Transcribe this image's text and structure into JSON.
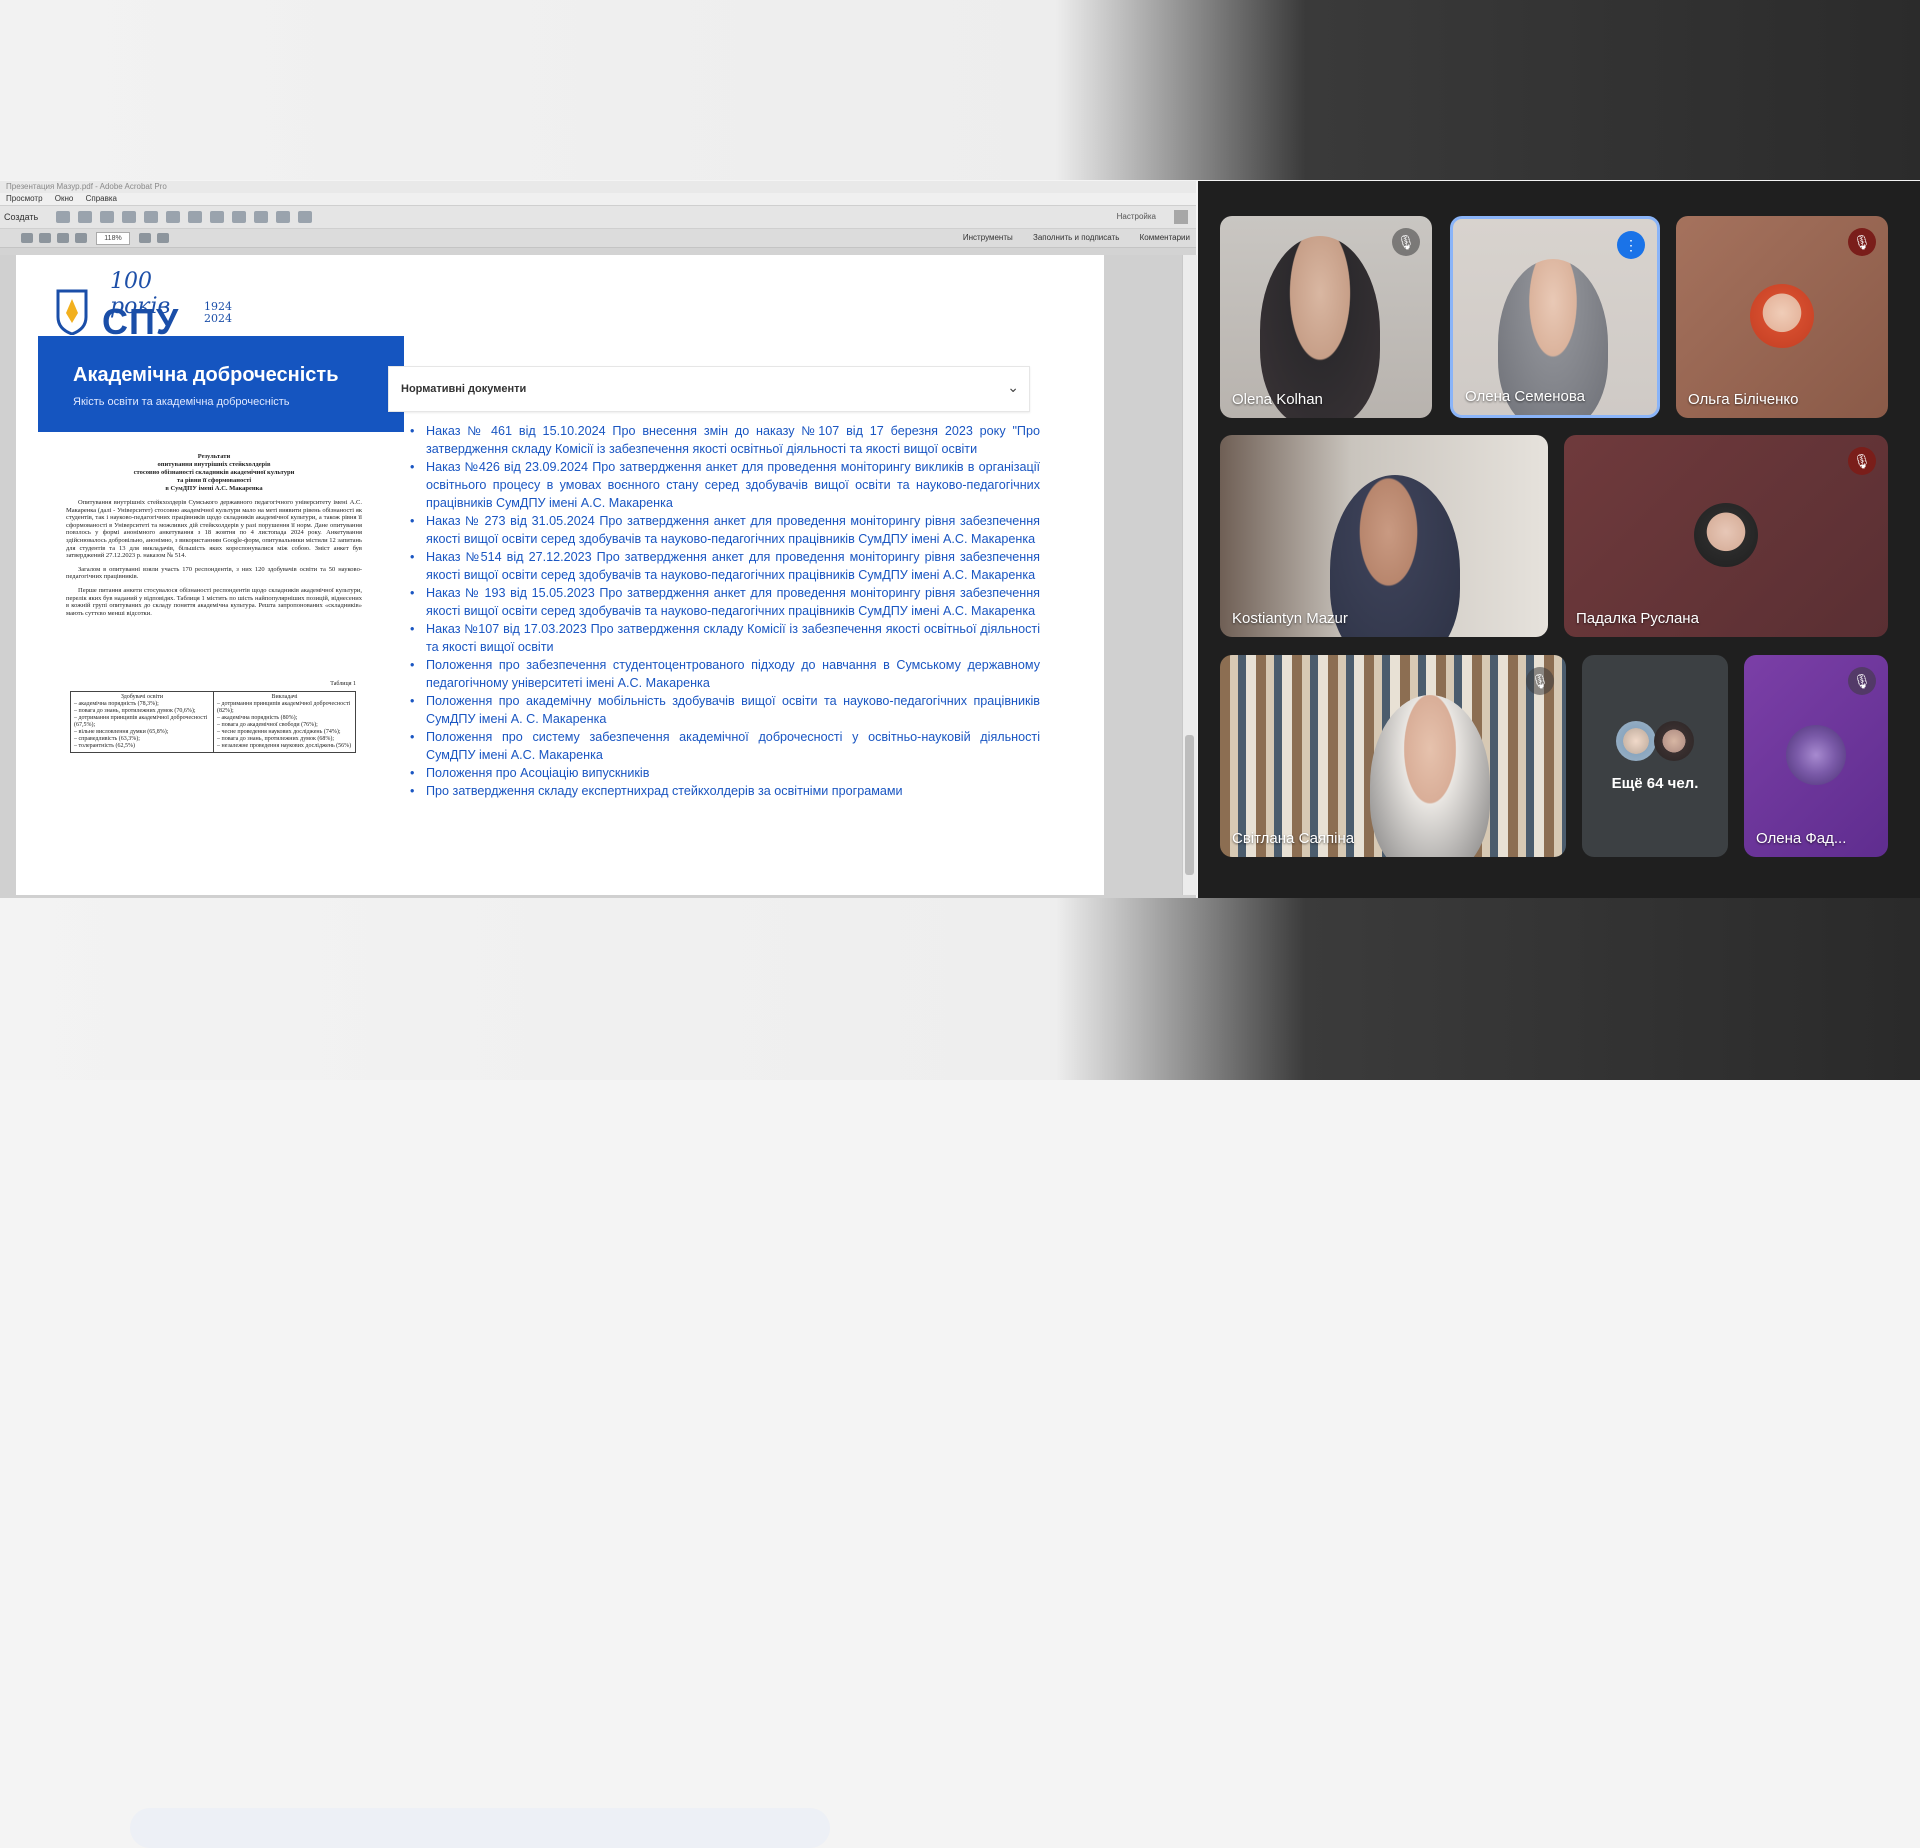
{
  "acrobat": {
    "window_title": "Презентация Мазур.pdf - Adobe Acrobat Pro",
    "menu": [
      "Просмотр",
      "Окно",
      "Справка"
    ],
    "create_label": "Создать",
    "customize_label": "Настройка",
    "zoom": "118%",
    "panels": [
      "Инструменты",
      "Заполнить и подписать",
      "Комментарии"
    ]
  },
  "slide": {
    "logo_text": "СПУ",
    "logo_years": "100 років",
    "logo_range": "1924\n2024",
    "banner_title": "Академічна доброчесність",
    "banner_subtitle": "Якість освіти та академічна доброчесність",
    "scan": {
      "title": "Результати\nопитування внутрішніх стейкхолдерів\nстосовно обізнаності складників академічної культури\nта рівня її сформованості\nв СумДПУ імені А.С. Макаренка",
      "para1": "Опитування внутрішніх стейкхолдерів Сумського державного педагогічного університету імені А.С. Макаренка (далі - Університет) стосовно академічної культури мало на меті виявити рівень обізнаності як студентів, так і науково-педагогічних працівників щодо складників академічної культури, а також рівня її сформованості в Університеті та можливих дій стейкхолдерів у разі порушення її норм. Дане опитування повзлось у формі анонімного анкетування з 18 жовтня по 4 листопада 2024 року. Анкетування здійснювалось добровільно, анонімно, з використанням Google-форм, опитувальники містили 12 запитань для студентів та 13 для викладачів, більшість яких кореспонувалися між собою. Зміст анкет був затверджений 27.12.2023 р. наказом № 514.",
      "para2": "Загалом в опитуванні взяли участь 170 респондентів, з них 120 здобувачів освіти та 50 науково-педагогічних працівників.",
      "para3": "Перше питання анкети стосувалося обізнаності респондентів щодо складників академічної культури, перелік яких був наданий у відповідях. Таблиця 1 містить по шість найпопулярніших позицій, віднесених в кожній групі опитуваних до складу поняття академічна культура. Решта запропонованих «складників» мають суттєво менші відсотки.",
      "table_label": "Таблиця 1",
      "col1_head": "Здобувачі освіти",
      "col1": "– академічна порядність (78,3%);\n– повага до знань, протилежних думок (70,6%);\n– дотримання принципів академічної доброчесності (67,5%);\n– вільне висловлення думки (65,8%);\n– справедливість (63,3%);\n– толерантність (62,5%)",
      "col2_head": "Викладачі",
      "col2": "– дотримання принципів академічної доброчесності (82%);\n– академічна порядність (80%);\n– повага до академічної свободи (76%);\n– чесне проведення наукових досліджень (74%);\n– повага до знань, протилежних думок (68%);\n– незалежне проведення наукових досліджень (56%)"
    },
    "norm_title": "Нормативні документи",
    "documents": [
      "Наказ № 461 від 15.10.2024  Про внесення змін до наказу №107 від 17 березня 2023 року \"Про затвердження складу Комісії із забезпечення якості освітньої діяльності та якості вищої освіти",
      "Наказ №426 від 23.09.2024 Про затвердження анкет для проведення моніторингу викликів в організації освітнього процесу в умовах воєнного стану серед здобувачів вищої освіти та науково-педагогічних працівників СумДПУ імені А.С. Макаренка",
      "Наказ № 273 від 31.05.2024 Про затвердження анкет для проведення моніторингу рівня забезпечення якості вищої освіти серед здобувачів та науково-педагогічних працівників СумДПУ імені А.С. Макаренка",
      "Наказ №514 від 27.12.2023 Про затвердження анкет для проведення моніторингу рівня забезпечення якості вищої освіти серед здобувачів та науково-педагогічних працівників СумДПУ імені А.С. Макаренка",
      "Наказ № 193 від 15.05.2023 Про затвердження анкет для проведення моніторингу рівня забезпечення якості вищої освіти серед здобувачів та науково-педагогічних працівників СумДПУ імені А.С. Макаренка",
      "Наказ №107 від 17.03.2023 Про затвердження складу Комісії із забезпечення якості освітньої діяльності та якості вищої освіти",
      "Положення про забезпечення студентоцентрованого підходу до навчання в Сумському державному педагогічному університеті імені А.С. Макаренка",
      "Положення про академічну мобільність здобувачів вищої освіти та науково-педагогічних працівників СумДПУ імені А. С. Макаренка",
      "Положення про систему забезпечення академічної доброчесності у освітньо-науковій діяльності СумДПУ імені А.С. Макаренка",
      "Положення про Асоціацію випускників",
      "Про затвердження складу експертнихрад стейкхолдерів за освітніми програмами"
    ]
  },
  "meet": {
    "participants": [
      {
        "name": "Olena Kolhan",
        "mic": "muted"
      },
      {
        "name": "Олена Семенова",
        "mic": "speaking"
      },
      {
        "name": "Ольга Біліченко",
        "mic": "muted-red"
      },
      {
        "name": "Kostiantyn Mazur",
        "mic": "on"
      },
      {
        "name": "Падалка Руслана",
        "mic": "muted-red"
      },
      {
        "name": "Світлана Саяпіна",
        "mic": "muted"
      },
      {
        "name": "Олена Фад...",
        "mic": "muted"
      }
    ],
    "more_label": "Ещё 64 чел.",
    "colors": {
      "tile_bg": "#3c4043",
      "speaking": "#1a73e8",
      "muted_red": "#7a1e1a"
    }
  }
}
